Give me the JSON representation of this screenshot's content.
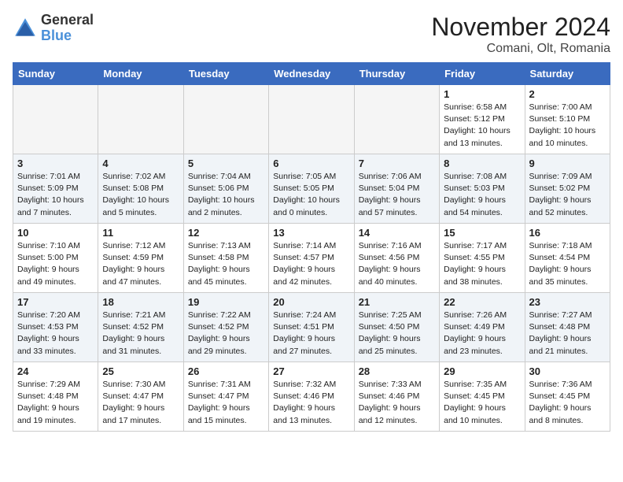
{
  "header": {
    "logo_general": "General",
    "logo_blue": "Blue",
    "month_title": "November 2024",
    "subtitle": "Comani, Olt, Romania"
  },
  "days_of_week": [
    "Sunday",
    "Monday",
    "Tuesday",
    "Wednesday",
    "Thursday",
    "Friday",
    "Saturday"
  ],
  "weeks": [
    [
      {
        "day": "",
        "info": ""
      },
      {
        "day": "",
        "info": ""
      },
      {
        "day": "",
        "info": ""
      },
      {
        "day": "",
        "info": ""
      },
      {
        "day": "",
        "info": ""
      },
      {
        "day": "1",
        "info": "Sunrise: 6:58 AM\nSunset: 5:12 PM\nDaylight: 10 hours\nand 13 minutes."
      },
      {
        "day": "2",
        "info": "Sunrise: 7:00 AM\nSunset: 5:10 PM\nDaylight: 10 hours\nand 10 minutes."
      }
    ],
    [
      {
        "day": "3",
        "info": "Sunrise: 7:01 AM\nSunset: 5:09 PM\nDaylight: 10 hours\nand 7 minutes."
      },
      {
        "day": "4",
        "info": "Sunrise: 7:02 AM\nSunset: 5:08 PM\nDaylight: 10 hours\nand 5 minutes."
      },
      {
        "day": "5",
        "info": "Sunrise: 7:04 AM\nSunset: 5:06 PM\nDaylight: 10 hours\nand 2 minutes."
      },
      {
        "day": "6",
        "info": "Sunrise: 7:05 AM\nSunset: 5:05 PM\nDaylight: 10 hours\nand 0 minutes."
      },
      {
        "day": "7",
        "info": "Sunrise: 7:06 AM\nSunset: 5:04 PM\nDaylight: 9 hours\nand 57 minutes."
      },
      {
        "day": "8",
        "info": "Sunrise: 7:08 AM\nSunset: 5:03 PM\nDaylight: 9 hours\nand 54 minutes."
      },
      {
        "day": "9",
        "info": "Sunrise: 7:09 AM\nSunset: 5:02 PM\nDaylight: 9 hours\nand 52 minutes."
      }
    ],
    [
      {
        "day": "10",
        "info": "Sunrise: 7:10 AM\nSunset: 5:00 PM\nDaylight: 9 hours\nand 49 minutes."
      },
      {
        "day": "11",
        "info": "Sunrise: 7:12 AM\nSunset: 4:59 PM\nDaylight: 9 hours\nand 47 minutes."
      },
      {
        "day": "12",
        "info": "Sunrise: 7:13 AM\nSunset: 4:58 PM\nDaylight: 9 hours\nand 45 minutes."
      },
      {
        "day": "13",
        "info": "Sunrise: 7:14 AM\nSunset: 4:57 PM\nDaylight: 9 hours\nand 42 minutes."
      },
      {
        "day": "14",
        "info": "Sunrise: 7:16 AM\nSunset: 4:56 PM\nDaylight: 9 hours\nand 40 minutes."
      },
      {
        "day": "15",
        "info": "Sunrise: 7:17 AM\nSunset: 4:55 PM\nDaylight: 9 hours\nand 38 minutes."
      },
      {
        "day": "16",
        "info": "Sunrise: 7:18 AM\nSunset: 4:54 PM\nDaylight: 9 hours\nand 35 minutes."
      }
    ],
    [
      {
        "day": "17",
        "info": "Sunrise: 7:20 AM\nSunset: 4:53 PM\nDaylight: 9 hours\nand 33 minutes."
      },
      {
        "day": "18",
        "info": "Sunrise: 7:21 AM\nSunset: 4:52 PM\nDaylight: 9 hours\nand 31 minutes."
      },
      {
        "day": "19",
        "info": "Sunrise: 7:22 AM\nSunset: 4:52 PM\nDaylight: 9 hours\nand 29 minutes."
      },
      {
        "day": "20",
        "info": "Sunrise: 7:24 AM\nSunset: 4:51 PM\nDaylight: 9 hours\nand 27 minutes."
      },
      {
        "day": "21",
        "info": "Sunrise: 7:25 AM\nSunset: 4:50 PM\nDaylight: 9 hours\nand 25 minutes."
      },
      {
        "day": "22",
        "info": "Sunrise: 7:26 AM\nSunset: 4:49 PM\nDaylight: 9 hours\nand 23 minutes."
      },
      {
        "day": "23",
        "info": "Sunrise: 7:27 AM\nSunset: 4:48 PM\nDaylight: 9 hours\nand 21 minutes."
      }
    ],
    [
      {
        "day": "24",
        "info": "Sunrise: 7:29 AM\nSunset: 4:48 PM\nDaylight: 9 hours\nand 19 minutes."
      },
      {
        "day": "25",
        "info": "Sunrise: 7:30 AM\nSunset: 4:47 PM\nDaylight: 9 hours\nand 17 minutes."
      },
      {
        "day": "26",
        "info": "Sunrise: 7:31 AM\nSunset: 4:47 PM\nDaylight: 9 hours\nand 15 minutes."
      },
      {
        "day": "27",
        "info": "Sunrise: 7:32 AM\nSunset: 4:46 PM\nDaylight: 9 hours\nand 13 minutes."
      },
      {
        "day": "28",
        "info": "Sunrise: 7:33 AM\nSunset: 4:46 PM\nDaylight: 9 hours\nand 12 minutes."
      },
      {
        "day": "29",
        "info": "Sunrise: 7:35 AM\nSunset: 4:45 PM\nDaylight: 9 hours\nand 10 minutes."
      },
      {
        "day": "30",
        "info": "Sunrise: 7:36 AM\nSunset: 4:45 PM\nDaylight: 9 hours\nand 8 minutes."
      }
    ]
  ]
}
